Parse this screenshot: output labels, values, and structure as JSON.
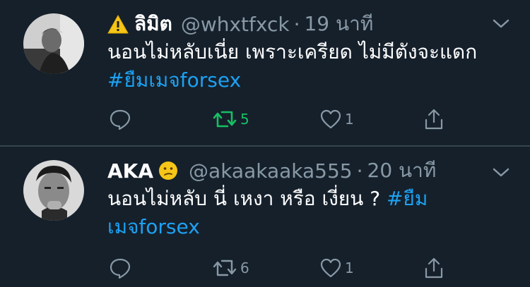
{
  "theme": {
    "background": "#15202b",
    "divider": "#38444d",
    "muted": "#8899a6",
    "link": "#1da1f2",
    "retweet_active": "#17bf63"
  },
  "tweets": [
    {
      "display_name": "ลิมิต",
      "name_prefix_icon": "warning-icon",
      "handle": "@whxtfxck",
      "separator": "·",
      "time": "19 นาที",
      "text": "นอนไม่หลับเนี่ย เพราะเครียด ไม่มีตังจะแดก",
      "hashtag": "#ยืมเมจforsex",
      "replies": "",
      "retweets": "5",
      "retweeted": true,
      "likes": "1"
    },
    {
      "display_name": "AKA",
      "name_badge_icon": "confused-face-emoji",
      "handle": "@akaakaaka555",
      "separator": "·",
      "time": "20 นาที",
      "text": "นอนไม่หลับ นี่ เหงา หรือ เงี่ยน ?",
      "hashtag_part1": "#ยืม",
      "hashtag_part2": "เมจforsex",
      "replies": "",
      "retweets": "6",
      "retweeted": false,
      "likes": "1"
    }
  ]
}
